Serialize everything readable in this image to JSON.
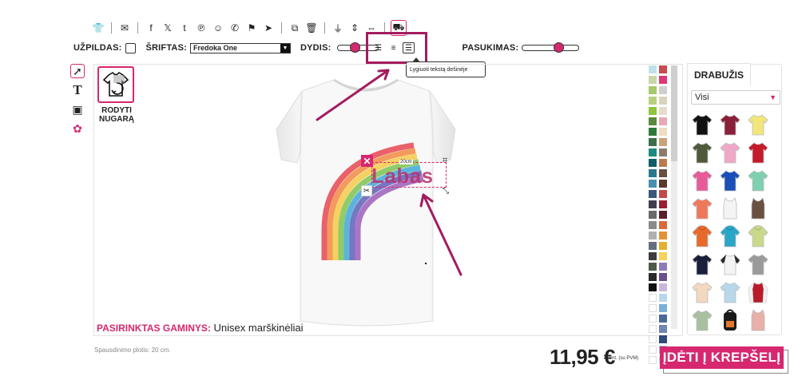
{
  "toolbar": {
    "top_icons": [
      {
        "name": "shirt-icon",
        "glyph": "👕"
      },
      {
        "name": "sep"
      },
      {
        "name": "email-icon",
        "glyph": "✉"
      },
      {
        "name": "sep"
      },
      {
        "name": "facebook-icon",
        "glyph": "f"
      },
      {
        "name": "x-icon",
        "glyph": "𝕏"
      },
      {
        "name": "tumblr-icon",
        "glyph": "t"
      },
      {
        "name": "pinterest-icon",
        "glyph": "℗"
      },
      {
        "name": "reddit-icon",
        "glyph": "☺"
      },
      {
        "name": "whatsapp-icon",
        "glyph": "✆"
      },
      {
        "name": "teams-icon",
        "glyph": "⚑"
      },
      {
        "name": "telegram-icon",
        "glyph": "➤"
      },
      {
        "name": "sep"
      },
      {
        "name": "copy-icon",
        "glyph": "⧉"
      },
      {
        "name": "trash-icon",
        "glyph": "🗑"
      },
      {
        "name": "sep"
      },
      {
        "name": "align-center-vertical-icon",
        "glyph": "⏚"
      },
      {
        "name": "flip-vertical-icon",
        "glyph": "⇕"
      },
      {
        "name": "flip-horizontal-icon",
        "glyph": "⇔"
      },
      {
        "name": "sep"
      },
      {
        "name": "preview-icon",
        "glyph": "⛟",
        "active": true
      }
    ],
    "fill_label": "UŽPILDAS:",
    "font_label": "ŠRIFTAS:",
    "font_value": "Fredoka One",
    "size_label": "DYDIS:",
    "size_level": 0.3,
    "rotation_label": "PASUKIMAS:",
    "rotation_level": 0.55,
    "align_tooltip": "Lygiuoti tekstą dešinėje"
  },
  "left_tools": [
    {
      "name": "select-tool-icon",
      "glyph": "➚",
      "active": true
    },
    {
      "name": "text-tool-icon",
      "glyph": "T"
    },
    {
      "name": "image-tool-icon",
      "glyph": "▣"
    },
    {
      "name": "clipart-tool-icon",
      "glyph": "✿"
    }
  ],
  "canvas": {
    "show_back_label": "RODYTI NUGARĄ",
    "design_text": "Labas",
    "measure": "20cm",
    "selected_label": "PASIRINKTAS GAMINYS:",
    "selected_value": "Unisex marškinėliai"
  },
  "colors": [
    "#bfe2ea",
    "#c94a4f",
    "#c9d6a8",
    "#e0367a",
    "#a7c86d",
    "#cfcfcf",
    "#b7d07e",
    "#d9d2bd",
    "#8fc43d",
    "#e5dccb",
    "#5a8a3e",
    "#e9a8b4",
    "#2f7a3a",
    "#f0dcc0",
    "#3d6e4b",
    "#c9a27b",
    "#1f8a80",
    "#8b7d6b",
    "#0f5e68",
    "#b97b4d",
    "#2b7a8c",
    "#6a5040",
    "#4a8fb0",
    "#5a3a2c",
    "#3a5878",
    "#c24a4a",
    "#3e3e4e",
    "#9a2030",
    "#6a6a6a",
    "#5a1f2e",
    "#8a8a8a",
    "#d96b3a",
    "#b0b0b0",
    "#e49038",
    "#666d80",
    "#e0b030",
    "#3d3d3d",
    "#f5d25a",
    "#4e5a4a",
    "#8f7bb8",
    "#2a2a2a",
    "#6a4e8e",
    "#111111",
    "#c9b7db",
    "#ffffff",
    "#b8d8ea",
    "#ffffff",
    "#7ab0d8",
    "#ffffff",
    "#4a6a9a",
    "#ffffff",
    "#6f86b0",
    "#ffffff",
    "#2e4a7a",
    "#ffffff",
    "#9ec3e0",
    "#ffffff",
    "#c8dff0"
  ],
  "apparel": {
    "tab": "DRABUŽIS",
    "filter_value": "Visi",
    "items": [
      {
        "name": "apparel-black-tee",
        "color": "#111111",
        "kind": "tee"
      },
      {
        "name": "apparel-burgundy-tee",
        "color": "#8a1f3a",
        "kind": "tee"
      },
      {
        "name": "apparel-yellow-tee",
        "color": "#f2e67a",
        "kind": "tee"
      },
      {
        "name": "apparel-olive-tee",
        "color": "#4e5a3a",
        "kind": "tee"
      },
      {
        "name": "apparel-pink-tee",
        "color": "#f0a8c8",
        "kind": "tee"
      },
      {
        "name": "apparel-red-tee",
        "color": "#c41a2a",
        "kind": "tee"
      },
      {
        "name": "apparel-hotpink-tee",
        "color": "#e85b9a",
        "kind": "tee"
      },
      {
        "name": "apparel-blue-tee",
        "color": "#1a4fb8",
        "kind": "tee"
      },
      {
        "name": "apparel-mint-tee",
        "color": "#7ed0b0",
        "kind": "tee"
      },
      {
        "name": "apparel-coral-tee",
        "color": "#f0785a",
        "kind": "tee"
      },
      {
        "name": "apparel-white-tank",
        "color": "#f4f4f4",
        "kind": "tank"
      },
      {
        "name": "apparel-brown-tank",
        "color": "#6a5040",
        "kind": "tank"
      },
      {
        "name": "apparel-orange-hoodie",
        "color": "#e86a2a",
        "kind": "hoodie"
      },
      {
        "name": "apparel-turquoise-hoodie",
        "color": "#2aa6c8",
        "kind": "hoodie"
      },
      {
        "name": "apparel-tiedye-hoodie",
        "color": "#c9d98a",
        "kind": "hoodie"
      },
      {
        "name": "apparel-navy-tee",
        "color": "#1a1f3a",
        "kind": "tee"
      },
      {
        "name": "apparel-raglan-tee",
        "color": "#2a2a2a",
        "kind": "raglan"
      },
      {
        "name": "apparel-grey-tee",
        "color": "#9a9a9a",
        "kind": "tee"
      },
      {
        "name": "apparel-peach-tee",
        "color": "#f3d8c0",
        "kind": "tee"
      },
      {
        "name": "apparel-lightblue-tee",
        "color": "#b8d8ea",
        "kind": "tee"
      },
      {
        "name": "apparel-varsity-jacket",
        "color": "#b81a2a",
        "kind": "jacket"
      },
      {
        "name": "apparel-sage-tee",
        "color": "#a8c0a0",
        "kind": "tee"
      },
      {
        "name": "apparel-black-backpack",
        "color": "#1a1a1a",
        "kind": "bag"
      },
      {
        "name": "apparel-rose-tank",
        "color": "#e8b0a8",
        "kind": "tank"
      }
    ]
  },
  "footer": {
    "print_width": "Spausdinimo plotis: 20 cm.",
    "price": "11,95 €",
    "vat_note": "vnt. (su PVM)",
    "cart_label": "ĮDĖTI Į KREPŠELĮ"
  },
  "brand_color": "#d6276f",
  "highlight_color": "#a31c5f"
}
